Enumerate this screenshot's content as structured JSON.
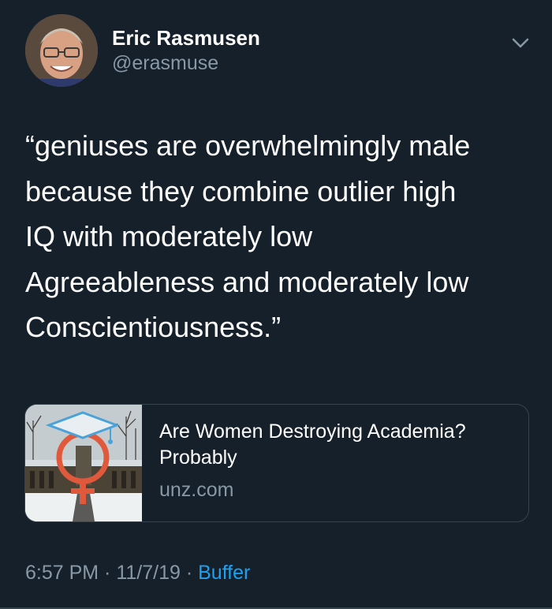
{
  "tweet": {
    "author": {
      "display_name": "Eric Rasmusen",
      "handle": "@erasmuse",
      "avatar_icon": "profile-photo"
    },
    "menu_icon": "chevron-down-icon",
    "text": "“geniuses are overwhelmingly male\nbecause they combine outlier high\nIQ with moderately low\nAgreeableness and moderately low\nConscientiousness.”",
    "link_card": {
      "title": "Are Women Destroying Academia? Probably",
      "domain": "unz.com",
      "image_icon": "venus-symbol-mortarboard-thumbnail"
    },
    "meta": {
      "time": "6:57 PM",
      "separator1": " · ",
      "date": "11/7/19",
      "separator2": " · ",
      "source": "Buffer"
    }
  },
  "colors": {
    "background": "#15202b",
    "primary_text": "#ffffff",
    "secondary_text": "#8899a6",
    "accent": "#1da1f2",
    "border": "#38444d",
    "venus_symbol": "#e0593c"
  }
}
